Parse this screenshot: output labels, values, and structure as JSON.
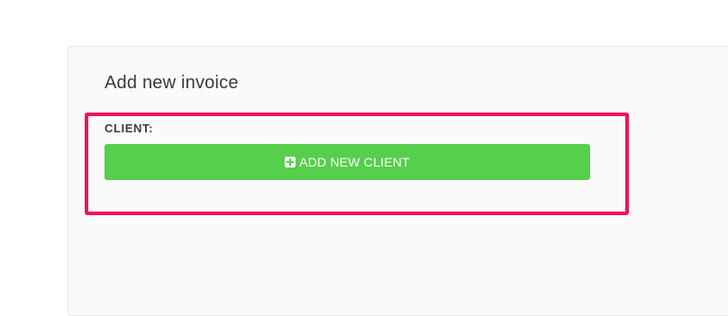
{
  "form": {
    "title": "Add new invoice",
    "client_label": "CLIENT:",
    "add_client_button": {
      "label": "ADD NEW CLIENT",
      "icon": "plus-square-icon"
    }
  },
  "colors": {
    "button_green": "#55cf4c",
    "highlight_border": "#f2125a",
    "card_background": "#fafafa"
  }
}
